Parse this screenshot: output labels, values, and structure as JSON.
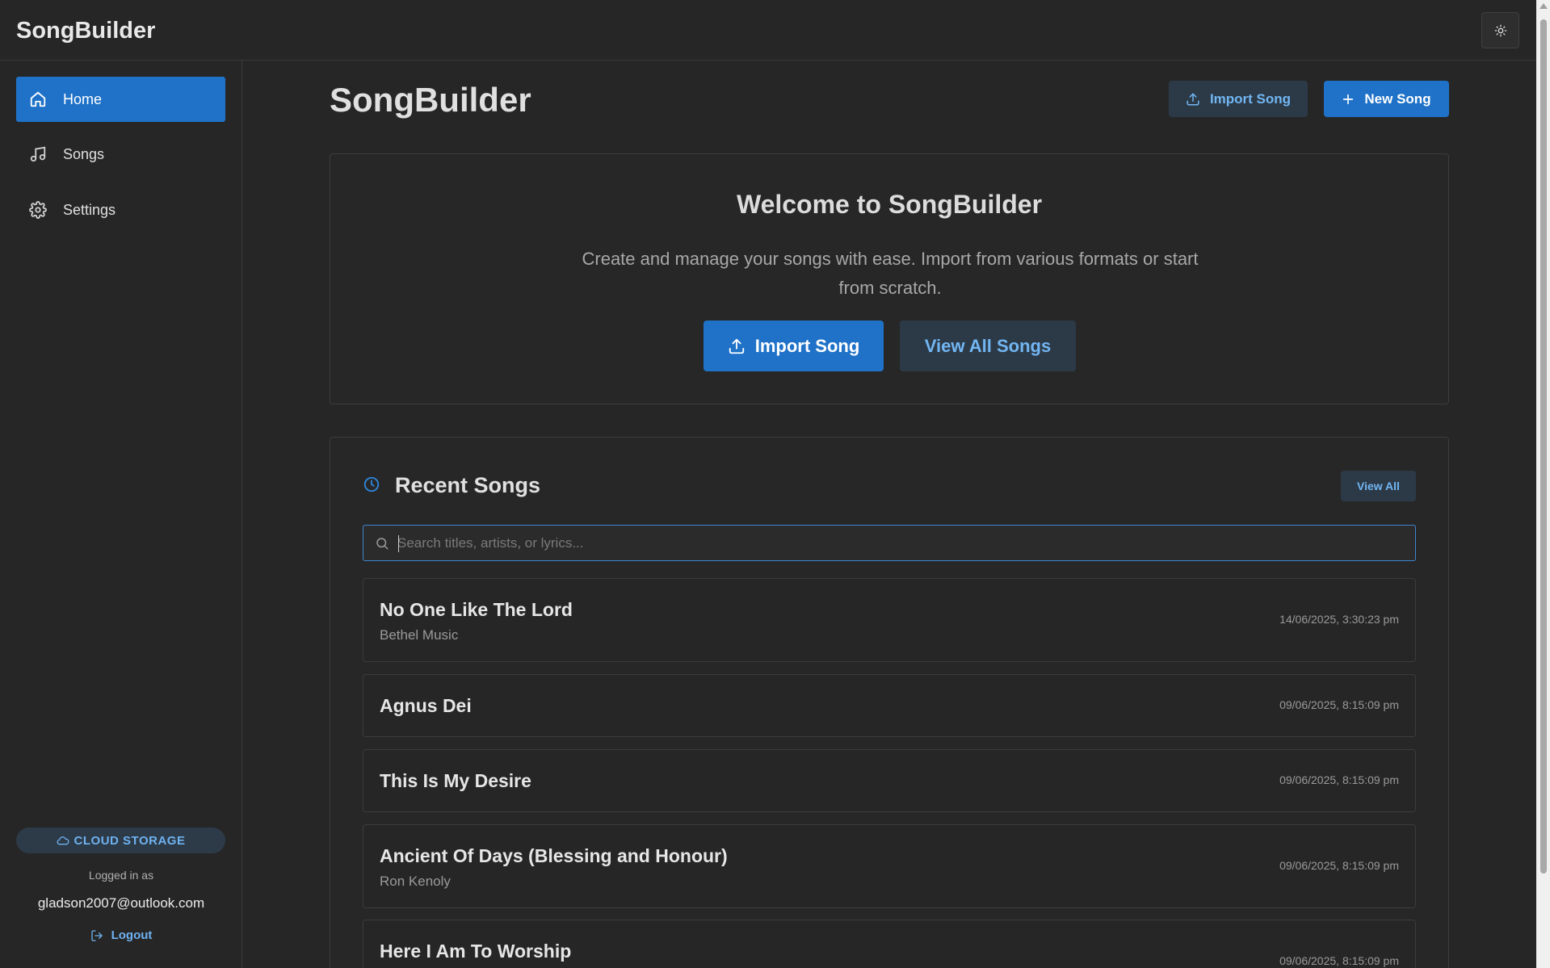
{
  "app": {
    "title": "SongBuilder"
  },
  "sidebar": {
    "items": [
      {
        "label": "Home",
        "icon": "home-icon",
        "active": true
      },
      {
        "label": "Songs",
        "icon": "music-note-icon",
        "active": false
      },
      {
        "label": "Settings",
        "icon": "gear-icon",
        "active": false
      }
    ],
    "storage_badge": "CLOUD STORAGE",
    "logged_in_label": "Logged in as",
    "user_email": "gladson2007@outlook.com",
    "logout_label": "Logout"
  },
  "header": {
    "title": "SongBuilder",
    "import_label": "Import Song",
    "new_label": "New Song"
  },
  "welcome": {
    "title": "Welcome to SongBuilder",
    "subtitle": "Create and manage your songs with ease. Import from various formats or start from scratch.",
    "import_label": "Import Song",
    "view_all_label": "View All Songs"
  },
  "recent": {
    "title": "Recent Songs",
    "view_all_label": "View All",
    "search_placeholder": "Search titles, artists, or lyrics...",
    "songs": [
      {
        "title": "No One Like The Lord",
        "artist": "Bethel Music",
        "date": "14/06/2025, 3:30:23 pm"
      },
      {
        "title": "Agnus Dei",
        "artist": "",
        "date": "09/06/2025, 8:15:09 pm"
      },
      {
        "title": "This Is My Desire",
        "artist": "",
        "date": "09/06/2025, 8:15:09 pm"
      },
      {
        "title": "Ancient Of Days (Blessing and Honour)",
        "artist": "Ron Kenoly",
        "date": "09/06/2025, 8:15:09 pm"
      },
      {
        "title": "Here I Am To Worship",
        "artist": "",
        "date": "09/06/2025, 8:15:09 pm"
      }
    ]
  },
  "colors": {
    "accent": "#1f72c8",
    "accent_text": "#72b6f2",
    "background": "#262626"
  }
}
